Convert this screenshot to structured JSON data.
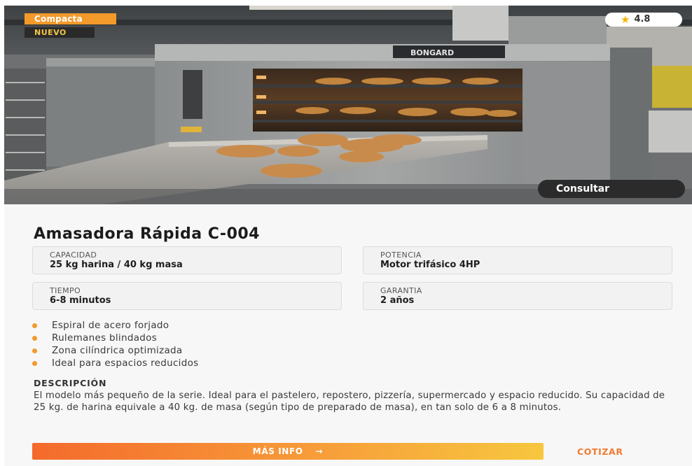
{
  "hero": {
    "category_badge": "Compacta",
    "new_badge": "NUEVO",
    "rating": "4.8",
    "oven_brand": "BONGARD",
    "consult_label": "Consultar"
  },
  "product": {
    "title": "Amasadora Rápida C-004",
    "specs": [
      {
        "label": "CAPACIDAD",
        "value": "25 kg harina / 40 kg masa"
      },
      {
        "label": "POTENCIA",
        "value": "Motor trifásico 4HP"
      },
      {
        "label": "TIEMPO",
        "value": "6-8 minutos"
      },
      {
        "label": "GARANTIA",
        "value": "2 años"
      }
    ],
    "features": [
      "Espiral de acero forjado",
      "Rulemanes blindados",
      "Zona cilíndrica optimizada",
      "Ideal para espacios reducidos"
    ],
    "description_heading": "DESCRIPCIÓN",
    "description": "El modelo más pequeño de la serie. Ideal para el pastelero, repostero, pizzería, supermercado y espacio reducido. Su capacidad de 25 kg. de harina equivale a 40 kg. de masa (según tipo de preparado de masa), en tan solo de 6 a 8 minutos."
  },
  "actions": {
    "more_info": "MÁS INFO",
    "quote": "COTIZAR"
  },
  "colors": {
    "accent": "#f39a2b",
    "accent_text": "#f07a2e",
    "new_badge_bg": "#2a2a2a"
  },
  "icons": {
    "rating": "star-icon",
    "more_info": "arrow-right-icon",
    "feature_bullet": "dot-icon"
  }
}
